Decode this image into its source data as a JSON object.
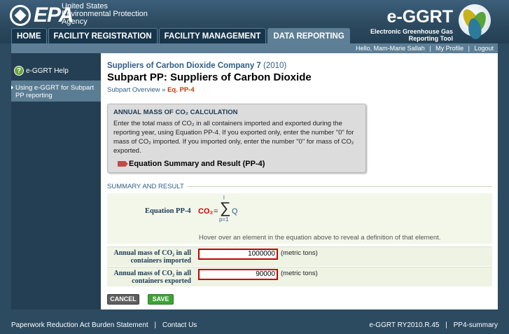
{
  "header": {
    "epa": "EPA",
    "agency_lines": [
      "United States",
      "Environmental Protection",
      "Agency"
    ],
    "app_title": "e-GGRT",
    "app_subtitle_lines": [
      "Electronic Greenhouse Gas",
      "Reporting Tool"
    ]
  },
  "nav": {
    "tabs": [
      "HOME",
      "FACILITY REGISTRATION",
      "FACILITY MANAGEMENT",
      "DATA REPORTING"
    ]
  },
  "userbar": {
    "greeting": "Hello, Mam-Marie Sallah",
    "profile": "My Profile",
    "logout": "Logout",
    "sep": "|"
  },
  "leftnav": {
    "help": "e-GGRT Help",
    "help_icon": "?",
    "link": "Using e-GGRT for Subpart PP reporting"
  },
  "main": {
    "company": "Suppliers of Carbon Dioxide Company 7",
    "year": "(2010)",
    "title": "Subpart PP: Suppliers of Carbon Dioxide",
    "crumb_overview": "Subpart Overview",
    "crumb_sep": "»",
    "crumb_current": "Eq. PP-4",
    "info_title": "ANNUAL MASS OF CO₂ CALCULATION",
    "info_text": "Enter the total mass of CO₂ in all containers imported and exported during the reporting year, using Equation PP-4. If you exported only, enter the number \"0\" for mass of CO₂ imported. If you imported only, enter the number \"0\" for mass of CO₂ exported.",
    "eq_link": "Equation Summary and Result (PP-4)",
    "section": "SUMMARY AND RESULT",
    "equation_label": "Equation PP-4",
    "eq": {
      "lhs": "CO₂",
      "eqsign": "=",
      "sigma": "∑",
      "top": "l",
      "bottom": "p=1",
      "term": "Q"
    },
    "hover_note": "Hover over an element in the equation above to reveal a definition of that element.",
    "rows": [
      {
        "label": "Annual mass of CO₂ in all containers imported",
        "value": "1000000",
        "unit": "(metric tons)"
      },
      {
        "label": "Annual mass of CO₂ in all containers exported",
        "value": "90000",
        "unit": "(metric tons)"
      }
    ],
    "cancel": "CANCEL",
    "save": "SAVE"
  },
  "footer": {
    "paperwork": "Paperwork Reduction Act Burden Statement",
    "contact": "Contact Us",
    "version": "e-GGRT RY2010.R.45",
    "page": "PP4-summary",
    "sep": "|"
  },
  "colors": {
    "header": "#2c4a60",
    "accent_red": "#c80000",
    "save_green": "#3da336",
    "link_blue": "#2f5e86"
  }
}
